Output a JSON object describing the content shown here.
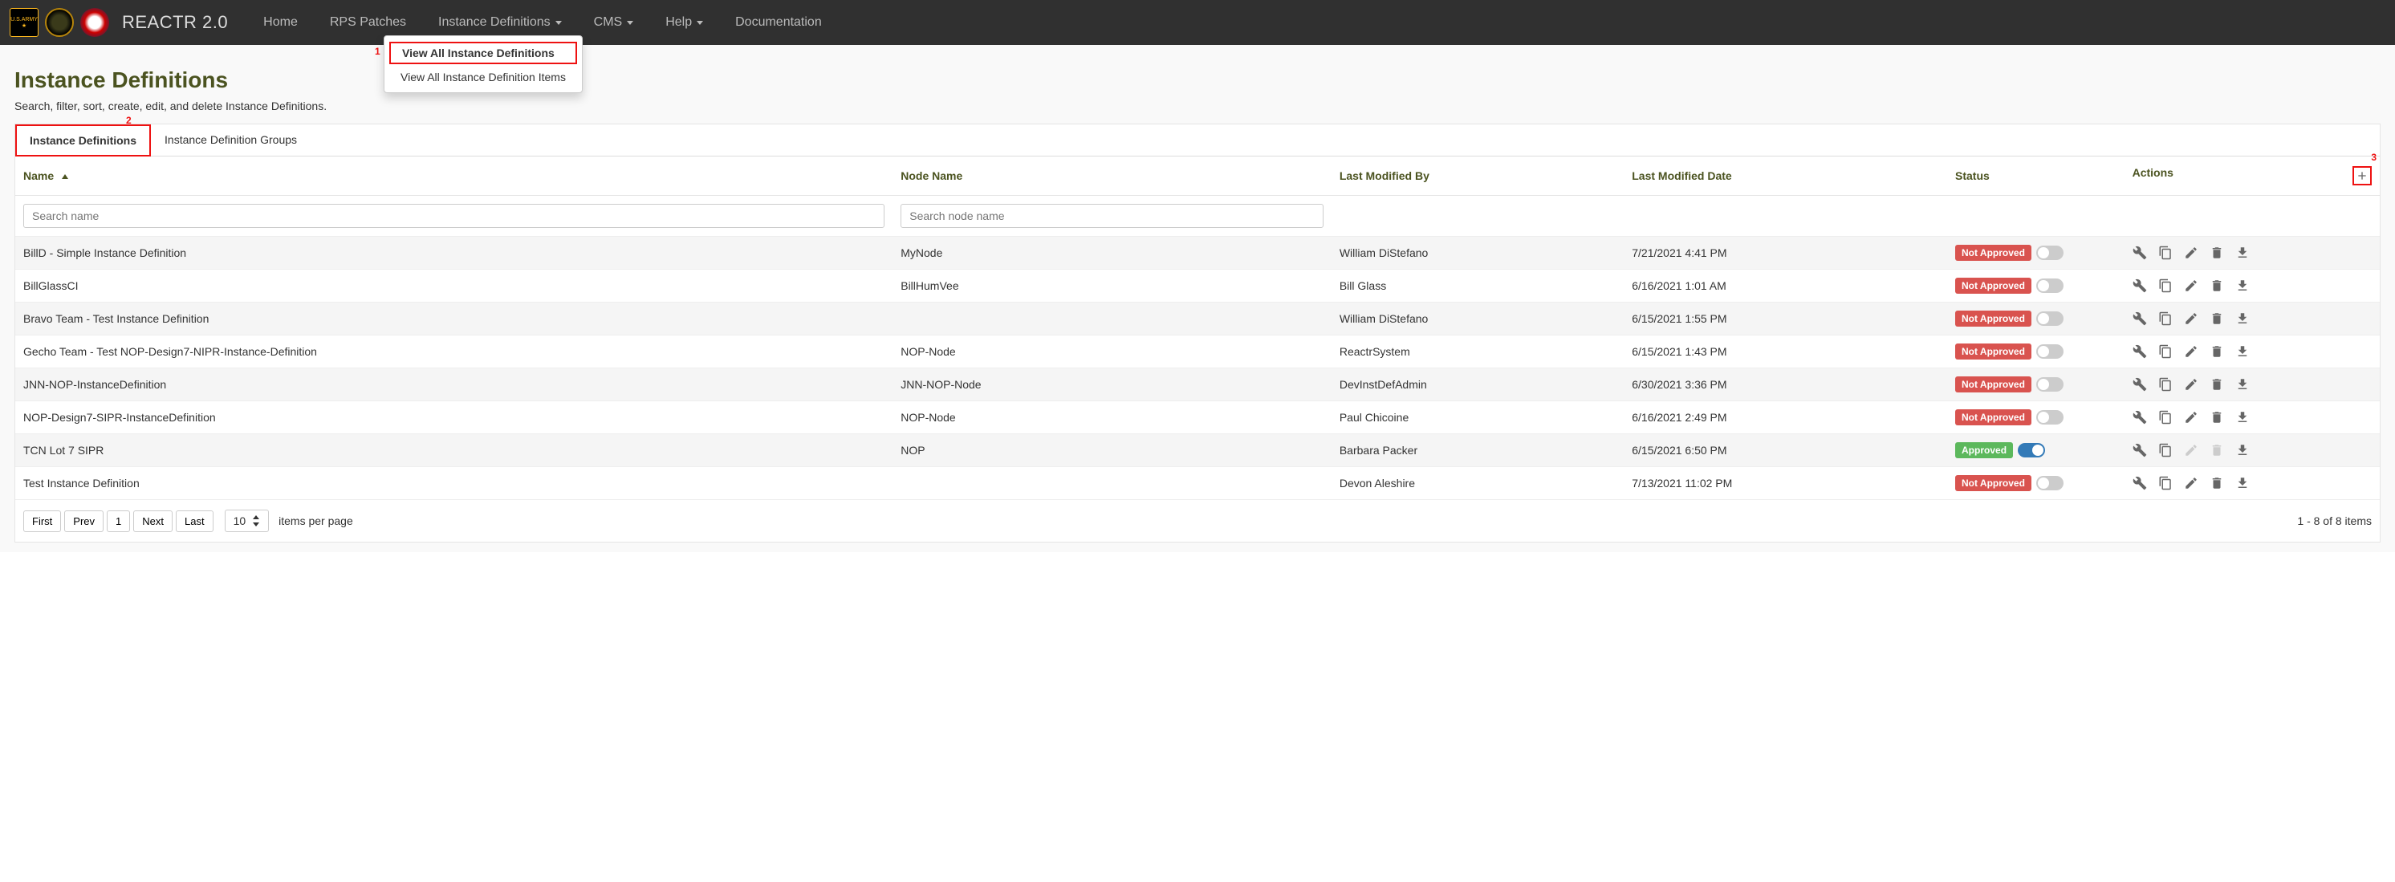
{
  "brand": "REACTR 2.0",
  "nav": {
    "home": "Home",
    "rps_patches": "RPS Patches",
    "instance_definitions": "Instance Definitions",
    "cms": "CMS",
    "help": "Help",
    "documentation": "Documentation"
  },
  "dropdown": {
    "view_all": "View All Instance Definitions",
    "view_items": "View All Instance Definition Items"
  },
  "callouts": {
    "one": "1",
    "two": "2",
    "three": "3"
  },
  "page": {
    "title": "Instance Definitions",
    "description": "Search, filter, sort, create, edit, and delete Instance Definitions."
  },
  "tabs": {
    "definitions": "Instance Definitions",
    "groups": "Instance Definition Groups"
  },
  "columns": {
    "name": "Name",
    "node_name": "Node Name",
    "modified_by": "Last Modified By",
    "modified_date": "Last Modified Date",
    "status": "Status",
    "actions": "Actions"
  },
  "filters": {
    "name_placeholder": "Search name",
    "node_placeholder": "Search node name"
  },
  "status_labels": {
    "approved": "Approved",
    "not_approved": "Not Approved"
  },
  "rows": [
    {
      "name": "BillD - Simple Instance Definition",
      "node": "MyNode",
      "by": "William DiStefano",
      "date": "7/21/2021 4:41 PM",
      "approved": false
    },
    {
      "name": "BillGlassCI",
      "node": "BillHumVee",
      "by": "Bill Glass",
      "date": "6/16/2021 1:01 AM",
      "approved": false
    },
    {
      "name": "Bravo Team - Test Instance Definition",
      "node": "",
      "by": "William DiStefano",
      "date": "6/15/2021 1:55 PM",
      "approved": false
    },
    {
      "name": "Gecho Team - Test NOP-Design7-NIPR-Instance-Definition",
      "node": "NOP-Node",
      "by": "ReactrSystem",
      "date": "6/15/2021 1:43 PM",
      "approved": false
    },
    {
      "name": "JNN-NOP-InstanceDefinition",
      "node": "JNN-NOP-Node",
      "by": "DevInstDefAdmin",
      "date": "6/30/2021 3:36 PM",
      "approved": false
    },
    {
      "name": "NOP-Design7-SIPR-InstanceDefinition",
      "node": "NOP-Node",
      "by": "Paul Chicoine",
      "date": "6/16/2021 2:49 PM",
      "approved": false
    },
    {
      "name": "TCN Lot 7 SIPR",
      "node": "NOP",
      "by": "Barbara Packer",
      "date": "6/15/2021 6:50 PM",
      "approved": true
    },
    {
      "name": "Test Instance Definition",
      "node": "",
      "by": "Devon Aleshire",
      "date": "7/13/2021 11:02 PM",
      "approved": false
    }
  ],
  "pager": {
    "first": "First",
    "prev": "Prev",
    "page": "1",
    "next": "Next",
    "last": "Last",
    "page_size": "10",
    "items_per_page": "items per page",
    "info": "1 - 8 of 8 items"
  }
}
